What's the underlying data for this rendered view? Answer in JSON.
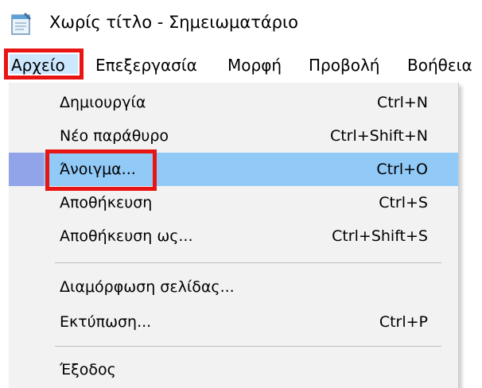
{
  "window": {
    "title": "Χωρίς τίτλο - Σημειωματάριο",
    "icon": "notepad-icon"
  },
  "menubar": {
    "items": [
      {
        "label": "Αρχείο",
        "state": "open"
      },
      {
        "label": "Επεξεργασία"
      },
      {
        "label": "Μορφή"
      },
      {
        "label": "Προβολή"
      },
      {
        "label": "Βοήθεια"
      }
    ]
  },
  "file_menu": {
    "items": [
      {
        "label": "Δημιουργία",
        "shortcut": "Ctrl+N"
      },
      {
        "label": "Νέο παράθυρο",
        "shortcut": "Ctrl+Shift+N"
      },
      {
        "label": "Άνοιγμα...",
        "shortcut": "Ctrl+O",
        "state": "highlighted"
      },
      {
        "label": "Αποθήκευση",
        "shortcut": "Ctrl+S"
      },
      {
        "label": "Αποθήκευση ως...",
        "shortcut": "Ctrl+Shift+S"
      },
      {
        "label": "Διαμόρφωση σελίδας..."
      },
      {
        "label": "Εκτύπωση...",
        "shortcut": "Ctrl+P"
      },
      {
        "label": "Έξοδος"
      }
    ]
  },
  "colors": {
    "menu_hover": "#91c9f7",
    "menubar_active": "#cce8ff",
    "annotation_red": "#e81515",
    "menu_background": "#f2f2f2"
  }
}
